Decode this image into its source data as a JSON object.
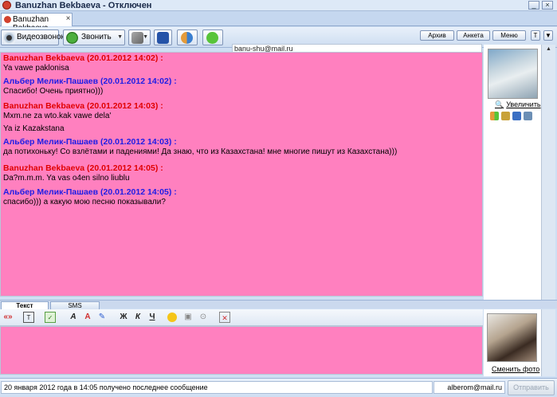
{
  "window": {
    "title": "Banuzhan Bekbaeva - Отключен",
    "minimize": "_",
    "close": "×"
  },
  "tab": {
    "label": "Banuzhan Bekbaeva",
    "close": "×"
  },
  "toolbar": {
    "video_label": "Видеозвонок",
    "call_label": "Звонить",
    "archive_label": "Архив",
    "profile_label": "Анкета",
    "menu_label": "Меню",
    "t_label": "T",
    "down_label": "▼"
  },
  "contact_email": "banu-shu@mail.ru",
  "messages": [
    {
      "author": "Banuzhan Bekbaeva (20.01.2012 14:02) :",
      "color": "red",
      "lines": [
        "Ya vawe paklonisa"
      ]
    },
    {
      "author": "Альбер Мелик-Пашаев (20.01.2012 14:02) :",
      "color": "blue",
      "lines": [
        "Спасибо! Очень приятно)))"
      ]
    },
    {
      "author": "Banuzhan Bekbaeva (20.01.2012 14:03) :",
      "color": "red",
      "lines": [
        "Mxm.ne za wto.kak vawe dela'",
        "Ya iz Kazakstana"
      ]
    },
    {
      "author": "Альбер Мелик-Пашаев (20.01.2012 14:03) :",
      "color": "blue",
      "lines": [
        "да потихоньку! Со взлётами и падениями! Да знаю, что из Казахстана! мне многие пишут из Казахстана)))"
      ]
    },
    {
      "author": "Banuzhan Bekbaeva (20.01.2012 14:05) :",
      "color": "red",
      "lines": [
        "Da?m.m.m. Ya vas o4en silno liublu"
      ]
    },
    {
      "author": "Альбер Мелик-Пашаев (20.01.2012 14:05) :",
      "color": "blue",
      "lines": [
        "спасибо))) а какую мою песню показывали?"
      ]
    }
  ],
  "side": {
    "zoom_label": "Увеличить",
    "change_photo_label": "Сменить фото"
  },
  "input_tabs": {
    "text": "Текст",
    "sms": "SMS"
  },
  "format": {
    "bold": "Ж",
    "italic": "К",
    "underline": "Ч",
    "arrows": "«»"
  },
  "status": {
    "text": "20 января 2012 года в 14:05 получено последнее сообщение",
    "email": "alberom@mail.ru",
    "send_label": "Отправить"
  },
  "colors": {
    "chat_bg": "#ff80bf",
    "author_red": "#e00000",
    "author_blue": "#1d1de6"
  }
}
